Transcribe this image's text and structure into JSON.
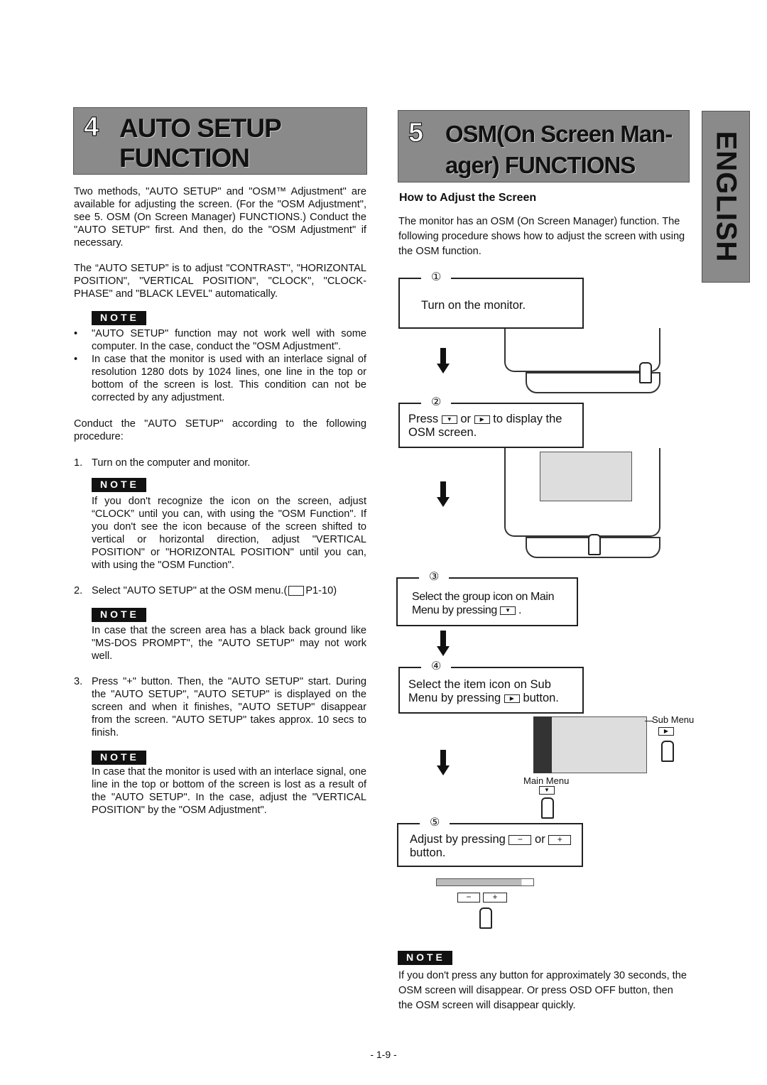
{
  "section4": {
    "number": "4",
    "title_line1": "AUTO SETUP",
    "title_line2": "FUNCTION",
    "para1": "Two methods, \"AUTO SETUP\" and \"OSM™ Adjustment\" are available for adjusting the screen.  (For the \"OSM Adjustment\", see 5. OSM (On Screen Manager) FUNCTIONS.)  Conduct the \"AUTO SETUP\" first.  And then, do the \"OSM Adjustment\" if necessary.",
    "para2": "The “AUTO SETUP” is to adjust \"CONTRAST\", \"HORIZONTAL POSITION\", \"VERTICAL POSITION\", \"CLOCK\", \"CLOCK-PHASE\" and \"BLACK LEVEL\" automatically.",
    "note_label": "NOTE",
    "note1_bullets": [
      "\"AUTO SETUP\" function may not work well with some computer.  In the case, conduct  the \"OSM Adjustment\".",
      "In case that the monitor is used with an interlace signal of resolution 1280 dots by 1024 lines, one line in the top or bottom of the screen is lost.  This condition can not be corrected by any adjustment."
    ],
    "para3": "Conduct the \"AUTO SETUP\" according to the following procedure:",
    "steps": [
      {
        "num": "1.",
        "text": "Turn on the computer and monitor.",
        "note": "If you don't recognize the icon on the screen, adjust “CLOCK” until you can, with using the \"OSM Function\". If you don't see the icon because of the screen shifted to vertical or horizontal direction, adjust \"VERTICAL POSITION\" or \"HORIZONTAL POSITION\" until you can, with using the \"OSM Function\"."
      },
      {
        "num": "2.",
        "text": "Select \"AUTO SETUP\" at the OSM menu.(",
        "ref": "P1-10)",
        "note": "In case that the screen area has a black back ground like \"MS-DOS PROMPT\", the \"AUTO SETUP\" may not work well."
      },
      {
        "num": "3.",
        "text": "Press \"+\" button.  Then, the \"AUTO SETUP\" start. During the \"AUTO SETUP\", \"AUTO SETUP\" is displayed on the screen and when it finishes, \"AUTO SETUP\" disappear from the screen. \"AUTO SETUP\" takes approx. 10 secs to finish.",
        "note": "In case that the monitor is used with an interlace signal, one line in the top or bottom of the screen is lost as a result of the \"AUTO SETUP\".  In the case, adjust the \"VERTICAL POSITION\" by the \"OSM Adjustment\"."
      }
    ]
  },
  "section5": {
    "number": "5",
    "title_line1": "OSM(On Screen Man-",
    "title_line2": "ager) FUNCTIONS",
    "subheading": "How to Adjust the Screen",
    "intro": "The monitor has an OSM (On Screen Manager) function. The following procedure shows how to adjust the screen with using the OSM function.",
    "flow": [
      {
        "num": "①",
        "text": "Turn on the monitor."
      },
      {
        "num": "②",
        "pre": "Press",
        "mid": "or",
        "post": "to display the OSM screen."
      },
      {
        "num": "③",
        "pre": "Select the group icon on Main Menu by pressing",
        "post": "."
      },
      {
        "num": "④",
        "pre": "Select the item icon on Sub Menu by pressing",
        "post": "button."
      },
      {
        "num": "⑤",
        "pre": "Adjust by pressing",
        "mid": "or",
        "post": "button."
      }
    ],
    "sub_menu_label": "Sub Menu",
    "main_menu_label": "Main Menu",
    "note_label": "NOTE",
    "note": "If you don't press any button for approximately 30 seconds, the OSM screen will disappear.  Or press OSD OFF button, then the OSM screen will disappear quickly."
  },
  "side_tab": "ENGLISH",
  "page_number": "- 1-9 -"
}
